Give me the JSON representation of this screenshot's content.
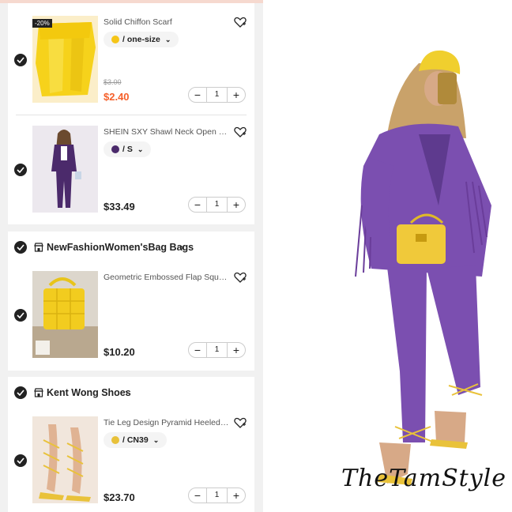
{
  "cart": {
    "stores": [
      {
        "name": "",
        "items": [
          {
            "title": "Solid Chiffon Scarf",
            "variant": "/ one-size",
            "variant_color": "#f5c518",
            "discount": "-20%",
            "old_price": "$3.00",
            "price": "$2.40",
            "quantity": "1",
            "selected": true
          },
          {
            "title": "SHEIN SXY Shawl Neck Open Front Blazer & Pants",
            "variant": "/ S",
            "variant_color": "#4b2a6b",
            "price": "$33.49",
            "quantity": "1",
            "selected": true
          }
        ]
      },
      {
        "name": "NewFashionWomen'sBag Bags",
        "items": [
          {
            "title": "Geometric Embossed Flap Square Bag",
            "price": "$10.20",
            "quantity": "1",
            "selected": true
          }
        ]
      },
      {
        "name": "Kent Wong Shoes",
        "items": [
          {
            "title": "Tie Leg Design Pyramid Heeled Sandals",
            "variant": "/ CN39",
            "variant_color": "#e8c13a",
            "price": "$23.70",
            "quantity": "1",
            "selected": true
          }
        ]
      }
    ]
  },
  "controls": {
    "minus": "−",
    "plus": "+",
    "chevron_right": "›",
    "chevron_down": "⌄"
  },
  "icons": {
    "check": "check-icon",
    "store": "store-icon",
    "wishlist": "heart-plus-icon"
  },
  "colors": {
    "sale_price": "#f5602a",
    "check_fill": "#222222",
    "outfit_purple": "#7b4fb0",
    "accessory_yellow": "#f0c93a"
  },
  "watermark": "TheTamStyle"
}
